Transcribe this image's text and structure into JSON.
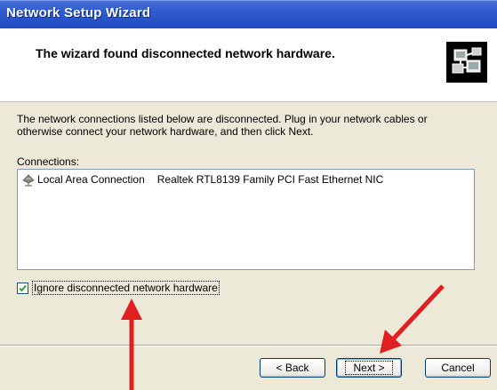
{
  "window": {
    "title": "Network Setup Wizard"
  },
  "header": {
    "heading": "The wizard found disconnected network hardware.",
    "icon": "network-wizard-icon"
  },
  "main": {
    "description": "The network connections listed below are disconnected. Plug in your network cables or otherwise connect your network hardware, and then click Next.",
    "connections_label": "Connections:",
    "connections": [
      {
        "name": "Local Area Connection",
        "device": "Realtek RTL8139 Family PCI Fast Ethernet NIC",
        "icon": "network-connection-icon"
      }
    ],
    "ignore_checkbox": {
      "label": "Ignore disconnected network hardware",
      "checked": true
    }
  },
  "buttons": {
    "back": "< Back",
    "next": "Next >",
    "cancel": "Cancel"
  },
  "annotations": {
    "color": "#e02020"
  }
}
